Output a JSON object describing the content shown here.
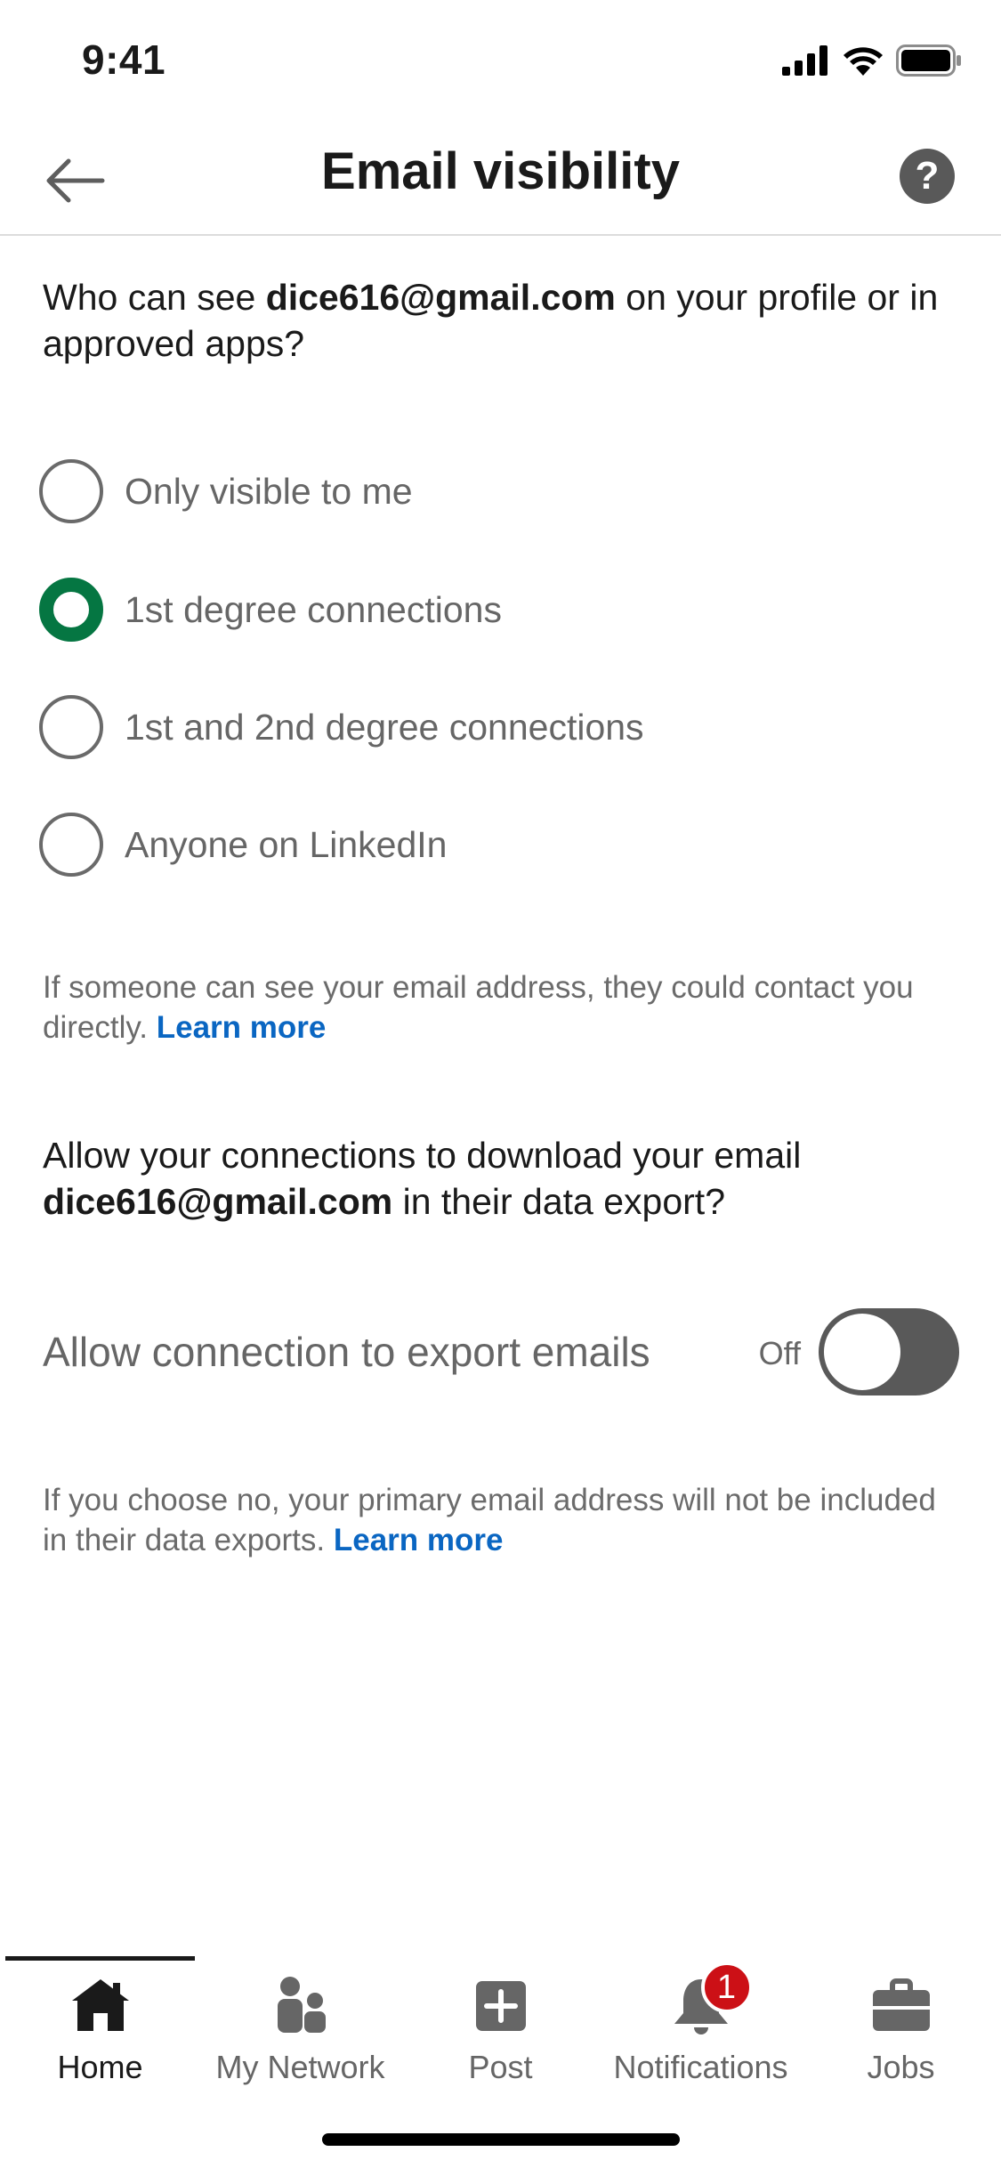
{
  "status_bar": {
    "time": "9:41"
  },
  "header": {
    "title": "Email visibility",
    "help_glyph": "?"
  },
  "visibility": {
    "question_prefix": "Who can see ",
    "email": "dice616@gmail.com",
    "question_suffix": " on your profile or in approved apps?",
    "options": [
      {
        "label": "Only visible to me",
        "selected": false
      },
      {
        "label": "1st degree connections",
        "selected": true
      },
      {
        "label": "1st and 2nd degree connections",
        "selected": false
      },
      {
        "label": "Anyone on LinkedIn",
        "selected": false
      }
    ],
    "info": "If someone can see your email address, they could contact you directly. ",
    "learn_more": "Learn more"
  },
  "export": {
    "question_prefix": "Allow your connections to download your email ",
    "email": "dice616@gmail.com",
    "question_suffix": " in their data export?",
    "toggle_label": "Allow connection to export emails",
    "toggle_state": "Off",
    "info": "If you choose no, your primary email address will not be included in their data exports. ",
    "learn_more": "Learn more"
  },
  "bottom_nav": {
    "items": [
      {
        "label": "Home",
        "icon": "home-icon",
        "active": true
      },
      {
        "label": "My Network",
        "icon": "people-icon",
        "active": false
      },
      {
        "label": "Post",
        "icon": "plus-icon",
        "active": false
      },
      {
        "label": "Notifications",
        "icon": "bell-icon",
        "active": false,
        "badge": "1"
      },
      {
        "label": "Jobs",
        "icon": "briefcase-icon",
        "active": false
      }
    ]
  },
  "colors": {
    "accent_green": "#057642",
    "link_blue": "#0a66c2",
    "badge_red": "#cc1016"
  }
}
